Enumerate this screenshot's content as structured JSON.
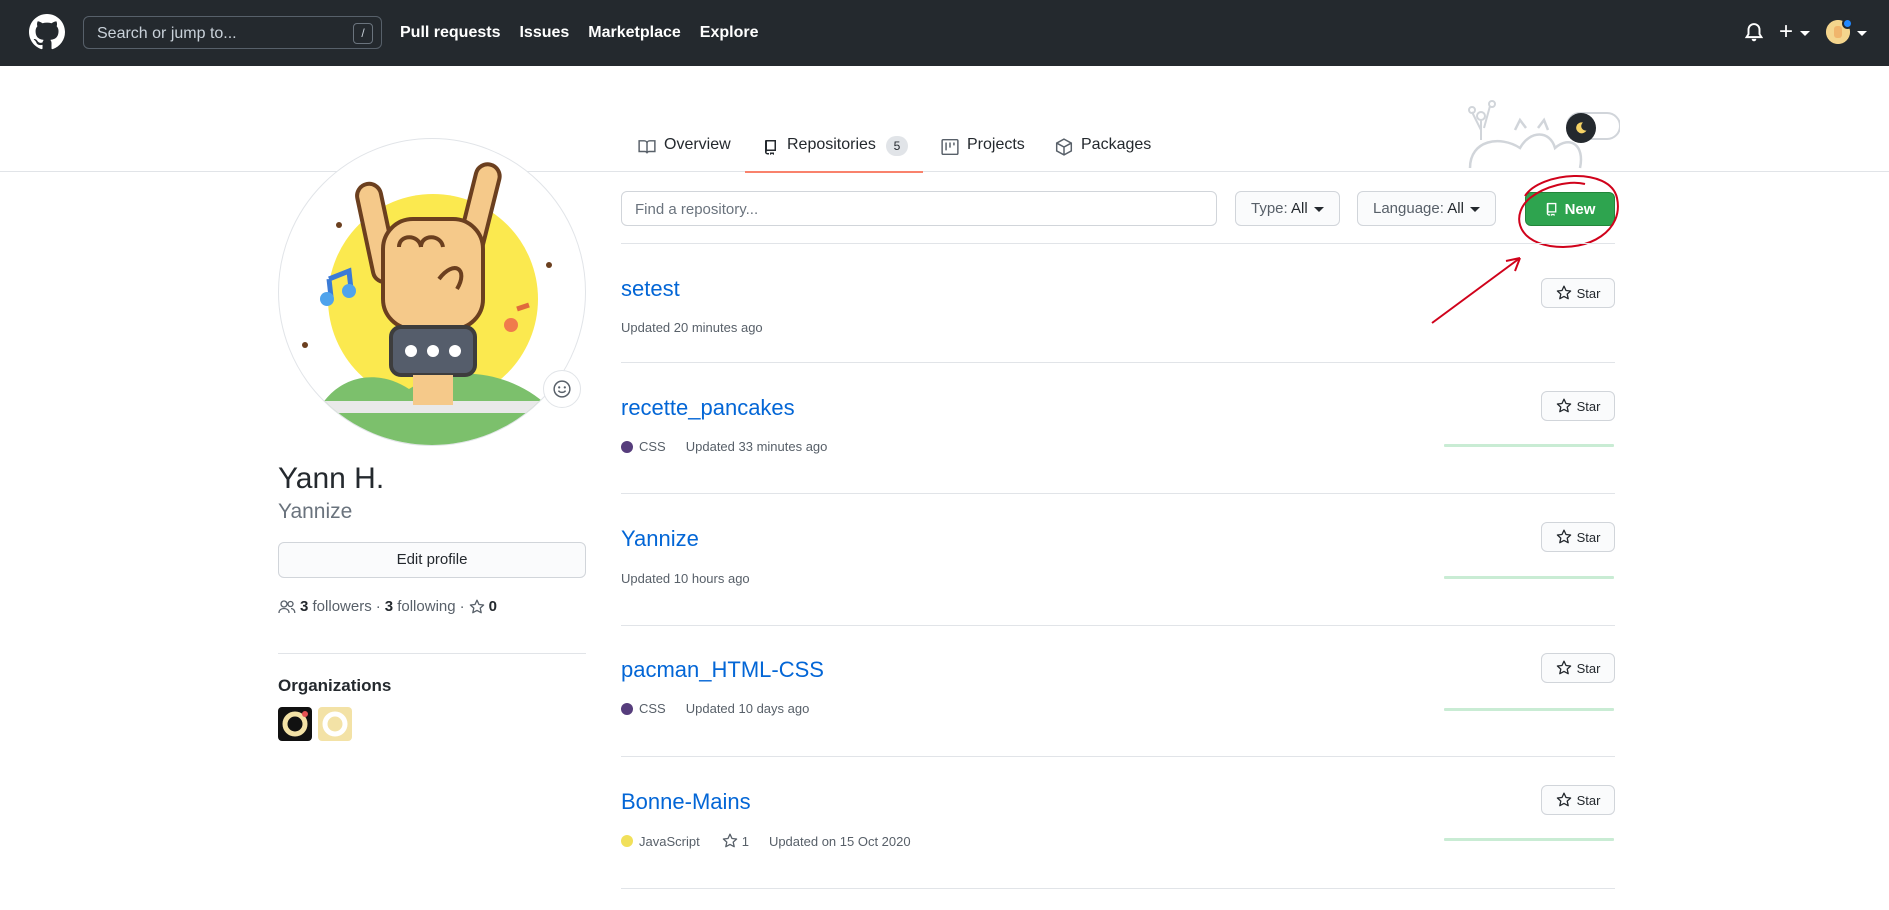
{
  "header": {
    "search_placeholder": "Search or jump to...",
    "slash_key": "/",
    "nav": [
      "Pull requests",
      "Issues",
      "Marketplace",
      "Explore"
    ]
  },
  "tabs": [
    {
      "label": "Overview",
      "icon": "book-icon"
    },
    {
      "label": "Repositories",
      "icon": "repo-icon",
      "count": "5"
    },
    {
      "label": "Projects",
      "icon": "project-icon"
    },
    {
      "label": "Packages",
      "icon": "package-icon"
    }
  ],
  "profile": {
    "full_name": "Yann H.",
    "username": "Yannize",
    "edit_label": "Edit profile",
    "followers_count": "3",
    "followers_label": "followers",
    "separator": "·",
    "following_count": "3",
    "following_label": "following",
    "stars_count": "0",
    "orgs_title": "Organizations"
  },
  "controls": {
    "find_placeholder": "Find a repository...",
    "type_label": "Type:",
    "type_value": "All",
    "language_label": "Language:",
    "language_value": "All",
    "new_label": "New"
  },
  "repos": [
    {
      "name": "setest",
      "language": "",
      "stars": "",
      "updated": "Updated 20 minutes ago"
    },
    {
      "name": "recette_pancakes",
      "language": "CSS",
      "lang_color": "#563d7c",
      "stars": "",
      "updated": "Updated 33 minutes ago"
    },
    {
      "name": "Yannize",
      "language": "",
      "stars": "",
      "updated": "Updated 10 hours ago"
    },
    {
      "name": "pacman_HTML-CSS",
      "language": "CSS",
      "lang_color": "#563d7c",
      "stars": "",
      "updated": "Updated 10 days ago"
    },
    {
      "name": "Bonne-Mains",
      "language": "JavaScript",
      "lang_color": "#f1e05a",
      "stars": "1",
      "updated": "Updated on 15 Oct 2020"
    }
  ],
  "star_label": "Star",
  "colors": {
    "header_bg": "#24292e",
    "link": "#0366d6",
    "new_button": "#2ea44f",
    "tab_underline": "#f9826c",
    "annotation": "#d0021b"
  }
}
